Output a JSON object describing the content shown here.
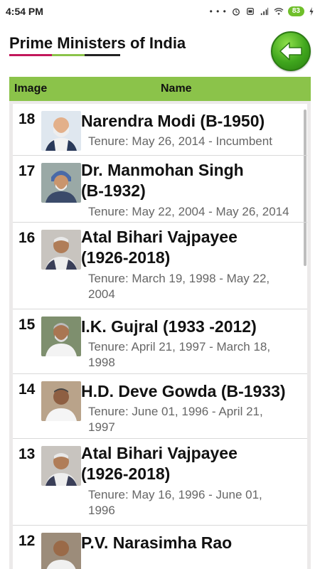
{
  "status": {
    "time": "4:54 PM",
    "dots": "• • •",
    "battery": "83"
  },
  "header": {
    "title": "Prime Ministers of India",
    "underline_colors": [
      "#c2185b",
      "#8bc34a",
      "#222222"
    ]
  },
  "table_header": {
    "image_label": "Image",
    "name_label": "Name",
    "color": "#8bc34a"
  },
  "rows": [
    {
      "number": "18",
      "name_line1": "Narendra Modi (B-1950)",
      "name_line2": "",
      "tenure_line1": "Tenure: May 26, 2014 - Incumbent",
      "tenure_line2": ""
    },
    {
      "number": "17",
      "name_line1": "Dr. Manmohan Singh",
      "name_line2": "(B-1932)",
      "tenure_line1": "Tenure: May 22, 2004 - May 26, 2014",
      "tenure_line2": ""
    },
    {
      "number": "16",
      "name_line1": "Atal Bihari Vajpayee",
      "name_line2": "(1926-2018)",
      "tenure_line1": "Tenure: March 19, 1998 - May 22,",
      "tenure_line2": "2004"
    },
    {
      "number": "15",
      "name_line1": "I.K. Gujral (1933 -2012)",
      "name_line2": "",
      "tenure_line1": "Tenure: April 21, 1997 - March 18,",
      "tenure_line2": "1998"
    },
    {
      "number": "14",
      "name_line1": "H.D. Deve Gowda (B-1933)",
      "name_line2": "",
      "tenure_line1": "Tenure: June 01, 1996 - April 21,",
      "tenure_line2": "1997"
    },
    {
      "number": "13",
      "name_line1": "Atal Bihari Vajpayee",
      "name_line2": "(1926-2018)",
      "tenure_line1": "Tenure: May 16, 1996 - June 01,",
      "tenure_line2": "1996"
    },
    {
      "number": "12",
      "name_line1": "P.V. Narasimha Rao",
      "name_line2": "",
      "tenure_line1": "",
      "tenure_line2": ""
    }
  ]
}
